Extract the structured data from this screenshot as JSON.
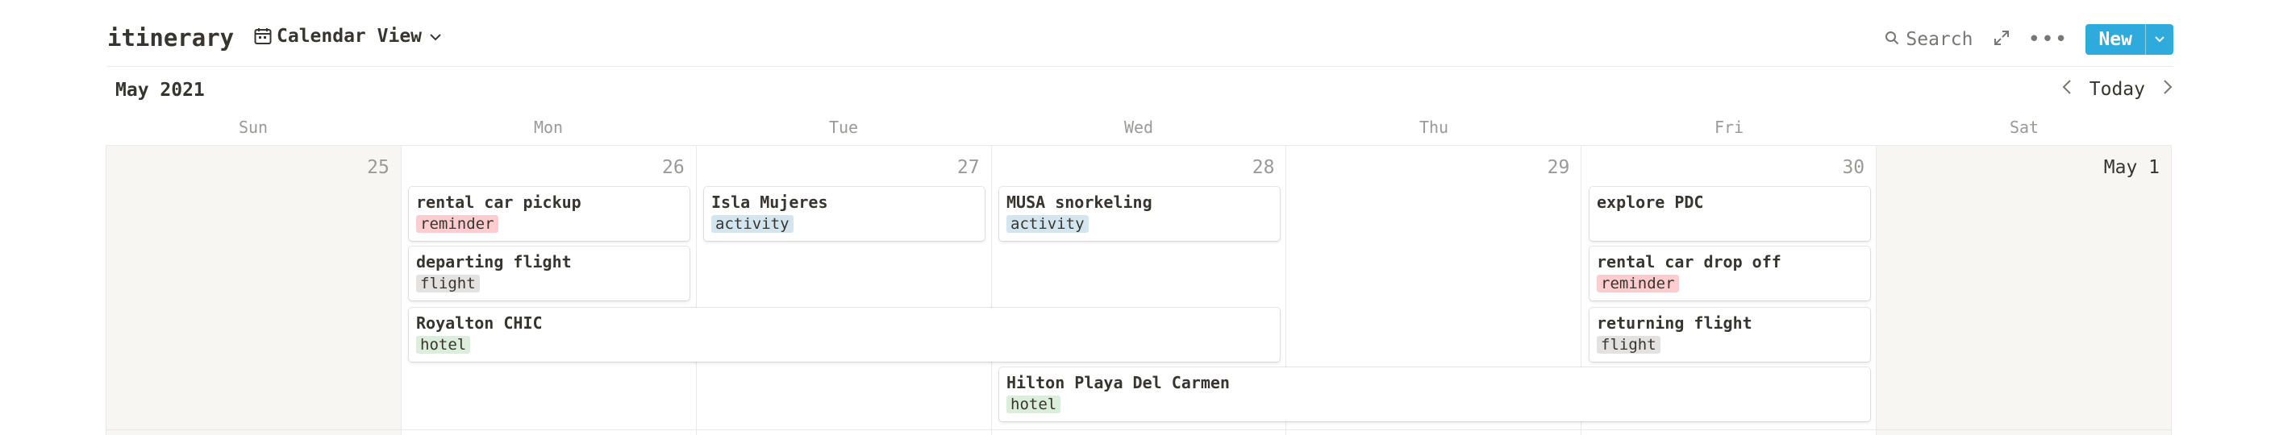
{
  "header": {
    "title": "itinerary",
    "view_label": "Calendar View",
    "search_label": "Search",
    "new_label": "New"
  },
  "calendar": {
    "month": "May 2021",
    "today_label": "Today",
    "weekdays": [
      "Sun",
      "Mon",
      "Tue",
      "Wed",
      "Thu",
      "Fri",
      "Sat"
    ],
    "days": [
      "25",
      "26",
      "27",
      "28",
      "29",
      "30",
      "May 1"
    ]
  },
  "tag_colors": {
    "reminder": "#ffcccf",
    "activity": "#d3e5ef",
    "flight": "#e3e2e0",
    "hotel": "#dbeddb"
  },
  "events": [
    {
      "title": "rental car pickup",
      "tag": "reminder"
    },
    {
      "title": "departing flight",
      "tag": "flight"
    },
    {
      "title": "Royalton CHIC",
      "tag": "hotel"
    },
    {
      "title": "Isla Mujeres",
      "tag": "activity"
    },
    {
      "title": "MUSA snorkeling",
      "tag": "activity"
    },
    {
      "title": "Hilton Playa Del Carmen",
      "tag": "hotel"
    },
    {
      "title": "explore PDC",
      "tag": ""
    },
    {
      "title": "rental car drop off",
      "tag": "reminder"
    },
    {
      "title": "returning flight",
      "tag": "flight"
    }
  ]
}
